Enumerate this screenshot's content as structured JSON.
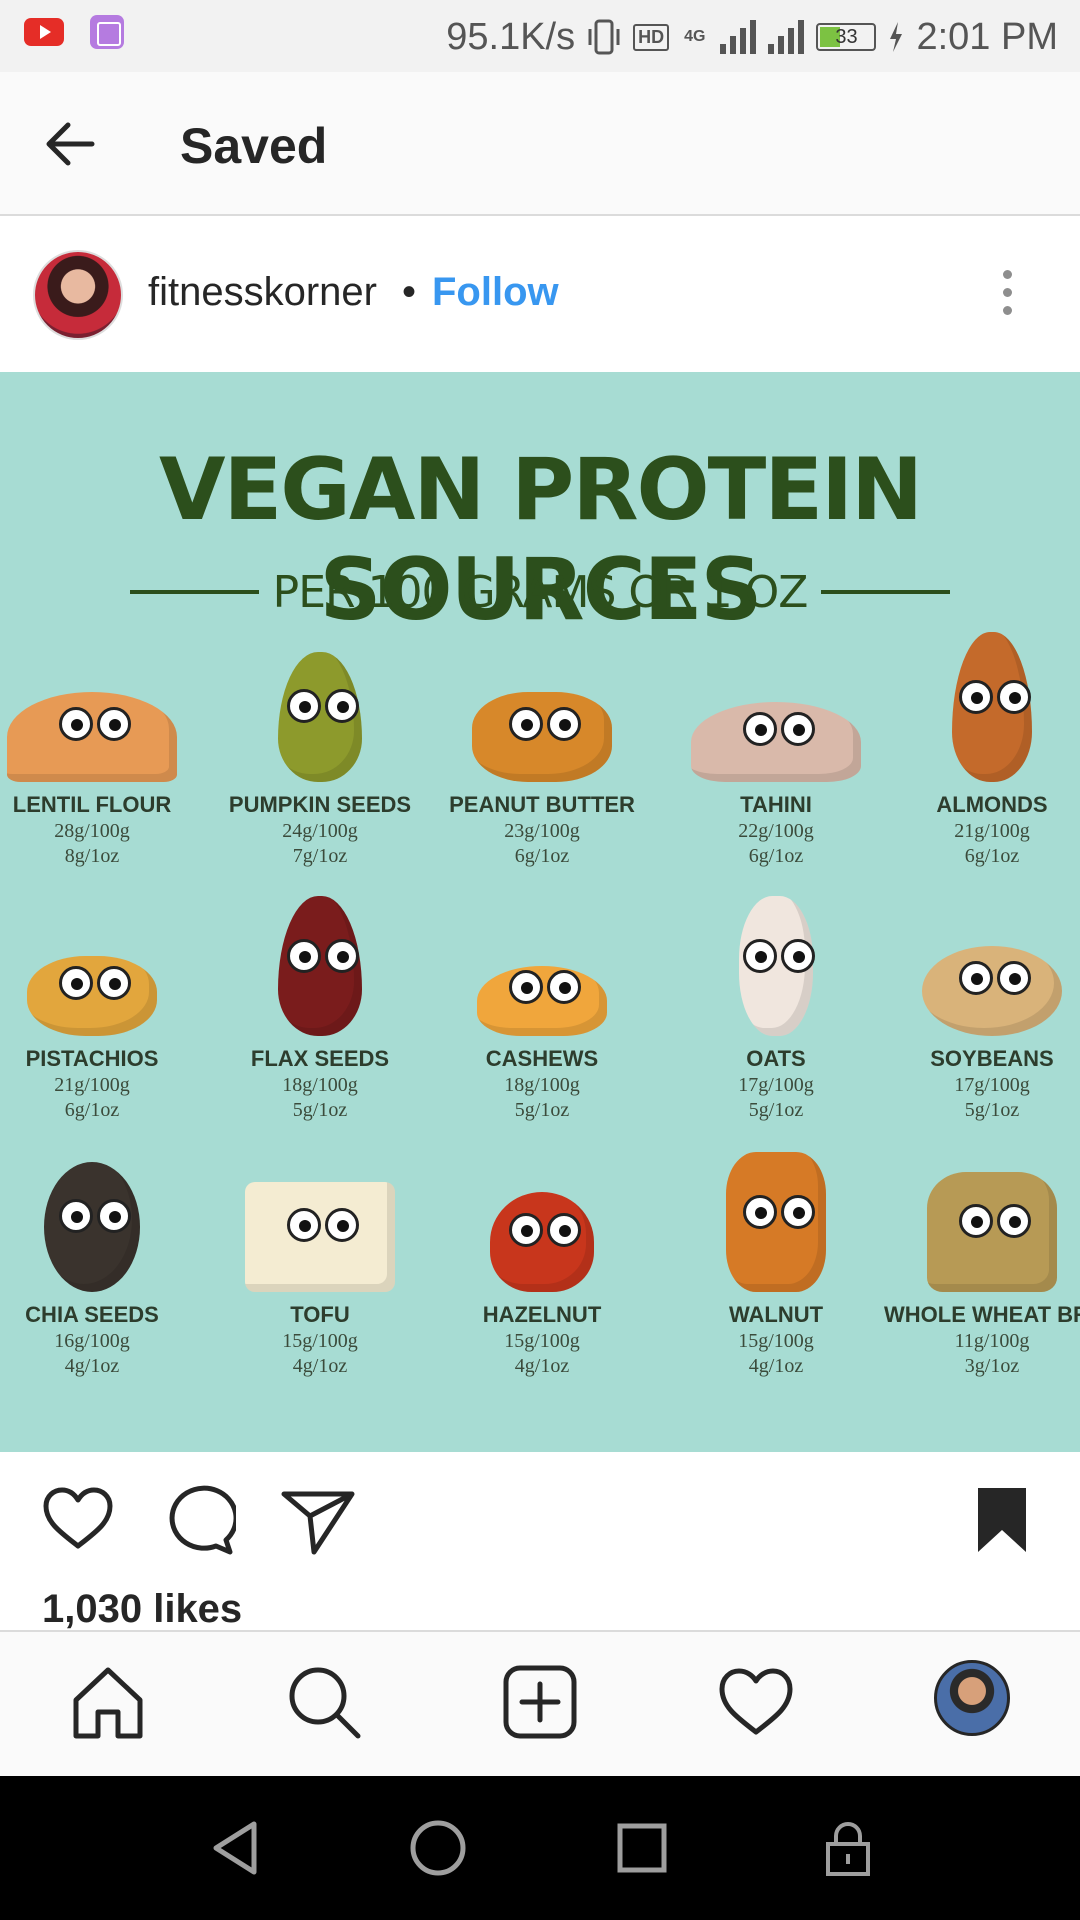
{
  "status_bar": {
    "speed": "95.1K/s",
    "hd": "HD",
    "network": "4G",
    "battery": "33",
    "time": "2:01 PM",
    "icons": [
      "youtube-icon",
      "gallery-icon",
      "vibrate-icon",
      "signal-icon",
      "battery-charging-icon"
    ]
  },
  "header": {
    "title": "Saved",
    "back_icon": "arrow-left-icon"
  },
  "post": {
    "username": "fitnesskorner",
    "separator": "•",
    "follow_label": "Follow",
    "more_icon": "more-vertical-icon",
    "image": {
      "title": "VEGAN PROTEIN SOURCES",
      "subtitle": "PER 100 GRAMS OR 1 OZ",
      "items": [
        {
          "name": "LENTIL FLOUR",
          "per100": "28g/100g",
          "peroz": "8g/1oz",
          "color": "#e79a55"
        },
        {
          "name": "PUMPKIN SEEDS",
          "per100": "24g/100g",
          "peroz": "7g/1oz",
          "color": "#8d9a2c"
        },
        {
          "name": "PEANUT BUTTER",
          "per100": "23g/100g",
          "peroz": "6g/1oz",
          "color": "#d7882a"
        },
        {
          "name": "TAHINI",
          "per100": "22g/100g",
          "peroz": "6g/1oz",
          "color": "#d9b9aa"
        },
        {
          "name": "ALMONDS",
          "per100": "21g/100g",
          "peroz": "6g/1oz",
          "color": "#c46a2b"
        },
        {
          "name": "PISTACHIOS",
          "per100": "21g/100g",
          "peroz": "6g/1oz",
          "color": "#e2a63d"
        },
        {
          "name": "FLAX SEEDS",
          "per100": "18g/100g",
          "peroz": "5g/1oz",
          "color": "#7a1c1c"
        },
        {
          "name": "CASHEWS",
          "per100": "18g/100g",
          "peroz": "5g/1oz",
          "color": "#f0a63c"
        },
        {
          "name": "OATS",
          "per100": "17g/100g",
          "peroz": "5g/1oz",
          "color": "#f0e6de"
        },
        {
          "name": "SOYBEANS",
          "per100": "17g/100g",
          "peroz": "5g/1oz",
          "color": "#d9b37a"
        },
        {
          "name": "CHIA SEEDS",
          "per100": "16g/100g",
          "peroz": "4g/1oz",
          "color": "#3a332d"
        },
        {
          "name": "TOFU",
          "per100": "15g/100g",
          "peroz": "4g/1oz",
          "color": "#f4ecd2"
        },
        {
          "name": "HAZELNUT",
          "per100": "15g/100g",
          "peroz": "4g/1oz",
          "color": "#c8361c"
        },
        {
          "name": "WALNUT",
          "per100": "15g/100g",
          "peroz": "4g/1oz",
          "color": "#d67a26"
        },
        {
          "name": "WHOLE WHEAT BRE",
          "per100": "11g/100g",
          "peroz": "3g/1oz",
          "color": "#b79a55"
        }
      ]
    },
    "action_icons": [
      "heart-icon",
      "comment-icon",
      "share-icon",
      "bookmark-icon"
    ],
    "likes": "1,030 likes"
  },
  "bottom_nav": {
    "icons": [
      "home-icon",
      "search-icon",
      "add-post-icon",
      "activity-heart-icon",
      "profile-avatar"
    ]
  },
  "system_nav": {
    "icons": [
      "back-triangle-icon",
      "home-circle-icon",
      "recents-square-icon",
      "lock-icon"
    ]
  }
}
